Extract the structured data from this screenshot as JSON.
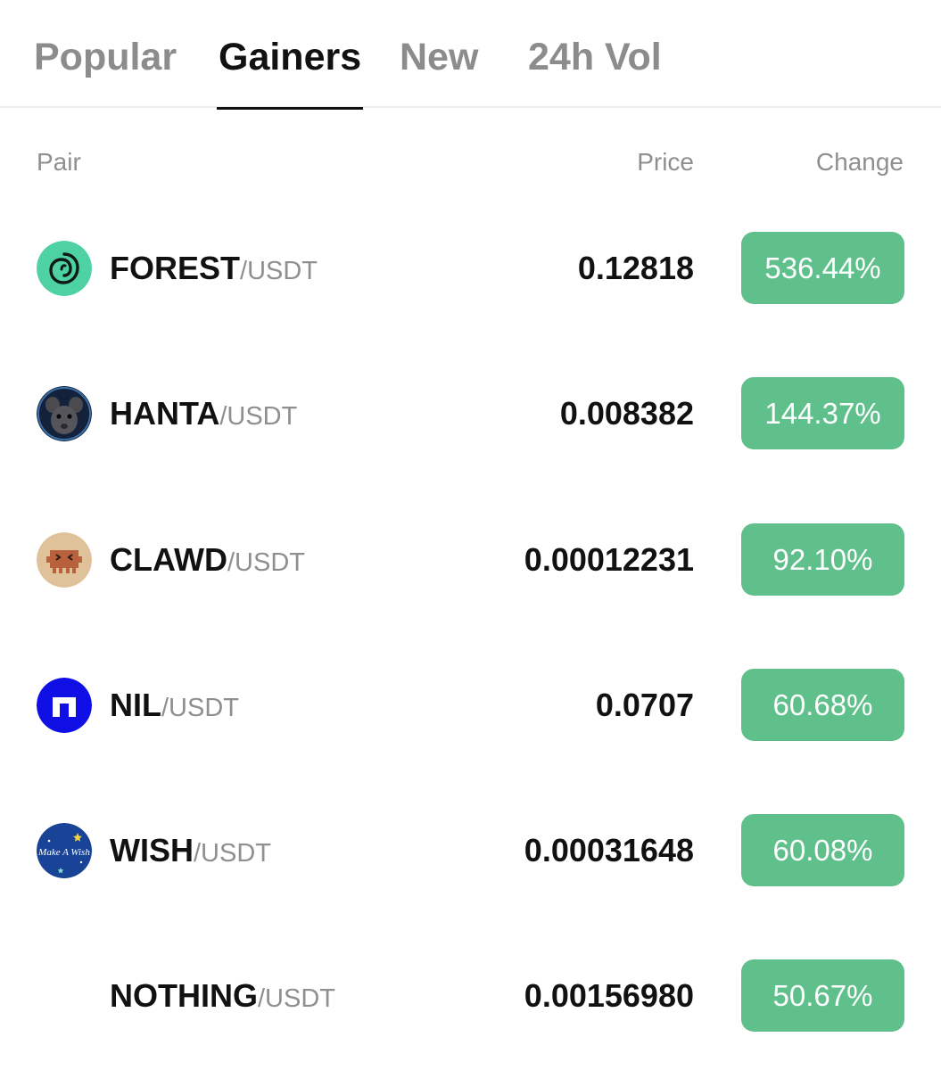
{
  "tabs": [
    {
      "label": "Popular",
      "active": false
    },
    {
      "label": "Gainers",
      "active": true
    },
    {
      "label": "New",
      "active": false
    },
    {
      "label": "24h Vol",
      "active": false
    }
  ],
  "headers": {
    "pair": "Pair",
    "price": "Price",
    "change": "Change"
  },
  "colors": {
    "gain": "#5fc08c",
    "text": "#111111",
    "muted": "#8f8f8f"
  },
  "rows": [
    {
      "base": "FOREST",
      "quote": "/USDT",
      "price": "0.12818",
      "change": "536.44%",
      "icon": "forest-coin-icon"
    },
    {
      "base": "HANTA",
      "quote": "/USDT",
      "price": "0.008382",
      "change": "144.37%",
      "icon": "hanta-coin-icon"
    },
    {
      "base": "CLAWD",
      "quote": "/USDT",
      "price": "0.00012231",
      "change": "92.10%",
      "icon": "clawd-coin-icon"
    },
    {
      "base": "NIL",
      "quote": "/USDT",
      "price": "0.0707",
      "change": "60.68%",
      "icon": "nil-coin-icon"
    },
    {
      "base": "WISH",
      "quote": "/USDT",
      "price": "0.00031648",
      "change": "60.08%",
      "icon": "wish-coin-icon",
      "icon_text": "Make A Wish"
    },
    {
      "base": "NOTHING",
      "quote": "/USDT",
      "price": "0.00156980",
      "change": "50.67%",
      "icon": ""
    }
  ]
}
